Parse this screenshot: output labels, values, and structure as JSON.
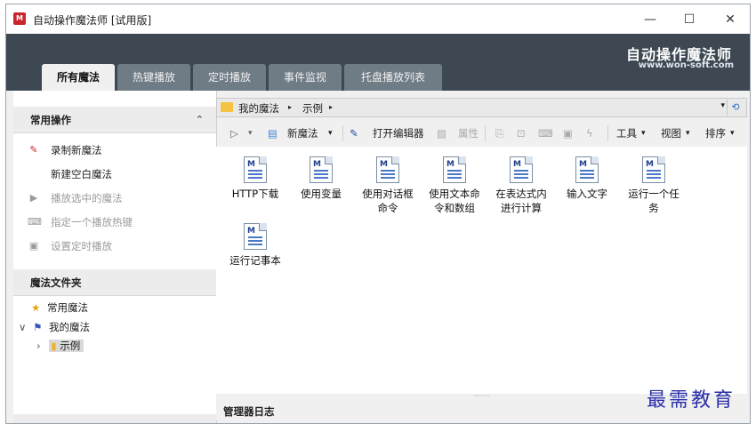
{
  "window": {
    "title": "自动操作魔法师 [试用版]",
    "app_icon_text": "M",
    "minimize": "—",
    "maximize": "☐",
    "close": "✕"
  },
  "banner": {
    "brand": "自动操作魔法师",
    "url": "www.won-soft.com"
  },
  "tabs": [
    {
      "label": "所有魔法",
      "active": true
    },
    {
      "label": "热键播放",
      "active": false
    },
    {
      "label": "定时播放",
      "active": false
    },
    {
      "label": "事件监视",
      "active": false
    },
    {
      "label": "托盘播放列表",
      "active": false
    }
  ],
  "left_panel": {
    "operations_title": "常用操作",
    "collapse_glyph": "⌃",
    "operations": [
      {
        "label": "录制新魔法",
        "icon": "✎",
        "enabled": true
      },
      {
        "label": "新建空白魔法",
        "icon": "",
        "enabled": true
      },
      {
        "label": "播放选中的魔法",
        "icon": "▶",
        "enabled": false
      },
      {
        "label": "指定一个播放热键",
        "icon": "⌨",
        "enabled": false
      },
      {
        "label": "设置定时播放",
        "icon": "▣",
        "enabled": false
      }
    ],
    "folders_title": "魔法文件夹",
    "tree": [
      {
        "label": "常用魔法",
        "icon": "★",
        "toggle": ""
      },
      {
        "label": "我的魔法",
        "icon": "⚑",
        "toggle": "∨"
      },
      {
        "label": "示例",
        "icon": "▮",
        "toggle": "›"
      }
    ]
  },
  "address_bar": {
    "segments": [
      "我的魔法",
      "▸",
      "示例",
      "▸"
    ],
    "dropdown": "▾",
    "refresh_icon": "⟲"
  },
  "toolbar": {
    "play": "▷",
    "play_dd": "▾",
    "new_macro": "新魔法",
    "new_dd": "▾",
    "open_editor": "打开编辑器",
    "properties": "属性",
    "tools": "工具",
    "view": "视图",
    "sort": "排序",
    "dd": "▾"
  },
  "macros": [
    {
      "name": "HTTP下载"
    },
    {
      "name": "使用变量"
    },
    {
      "name": "使用对话框命令"
    },
    {
      "name": "使用文本命令和数组"
    },
    {
      "name": "在表达式内进行计算"
    },
    {
      "name": "输入文字"
    },
    {
      "name": "运行一个任务"
    },
    {
      "name": "运行记事本"
    }
  ],
  "splitter_dots": "·······",
  "log_panel": {
    "title": "管理器日志"
  },
  "watermark": "最需教育",
  "colors": {
    "banner": "#3d4852",
    "tab_inactive": "#6f7b85",
    "accent_text": "#2a2fa8"
  }
}
